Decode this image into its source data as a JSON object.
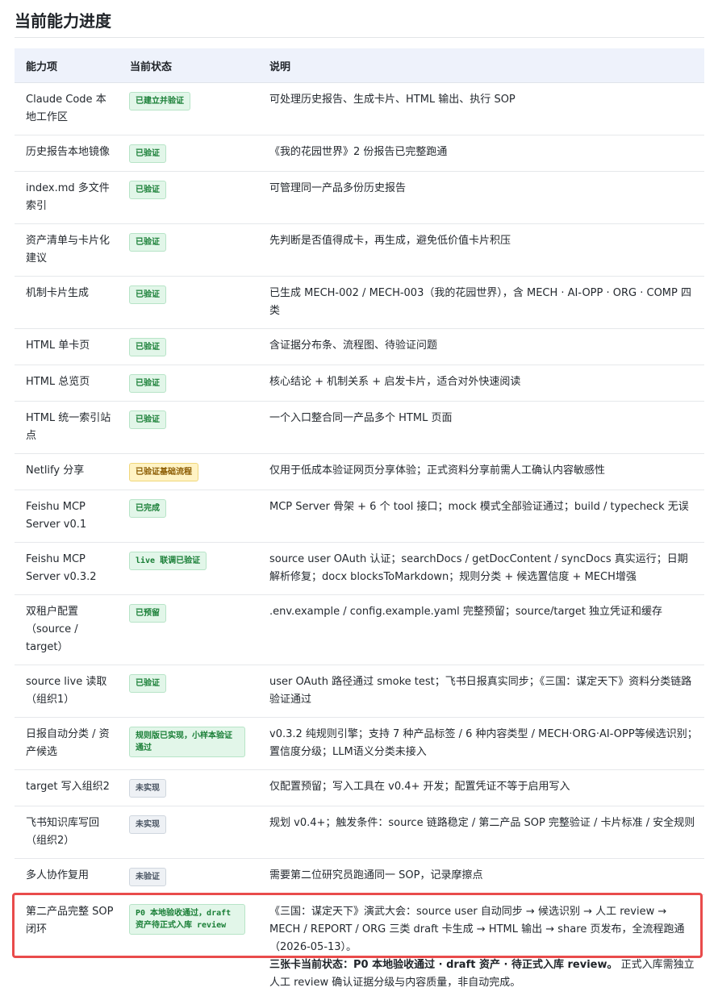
{
  "page": {
    "title": "当前能力进度"
  },
  "table": {
    "headers": [
      "能力项",
      "当前状态",
      "说明"
    ],
    "rows": [
      {
        "item": "Claude Code 本地工作区",
        "status": "已建立并验证",
        "status_color": "green",
        "desc": "可处理历史报告、生成卡片、HTML 输出、执行 SOP"
      },
      {
        "item": "历史报告本地镜像",
        "status": "已验证",
        "status_color": "green",
        "desc": "《我的花园世界》2 份报告已完整跑通"
      },
      {
        "item": "index.md 多文件索引",
        "status": "已验证",
        "status_color": "green",
        "desc": "可管理同一产品多份历史报告"
      },
      {
        "item": "资产清单与卡片化建议",
        "status": "已验证",
        "status_color": "green",
        "desc": "先判断是否值得成卡，再生成，避免低价值卡片积压"
      },
      {
        "item": "机制卡片生成",
        "status": "已验证",
        "status_color": "green",
        "desc": "已生成 MECH-002 / MECH-003（我的花园世界），含 MECH · AI-OPP · ORG · COMP 四类"
      },
      {
        "item": "HTML 单卡页",
        "status": "已验证",
        "status_color": "green",
        "desc": "含证据分布条、流程图、待验证问题"
      },
      {
        "item": "HTML 总览页",
        "status": "已验证",
        "status_color": "green",
        "desc": "核心结论 + 机制关系 + 启发卡片，适合对外快速阅读"
      },
      {
        "item": "HTML 统一索引站点",
        "status": "已验证",
        "status_color": "green",
        "desc": "一个入口整合同一产品多个 HTML 页面"
      },
      {
        "item": "Netlify 分享",
        "status": "已验证基础流程",
        "status_color": "yellow",
        "desc": "仅用于低成本验证网页分享体验；正式资料分享前需人工确认内容敏感性"
      },
      {
        "item": "Feishu MCP Server v0.1",
        "status": "已完成",
        "status_color": "green",
        "desc": "MCP Server 骨架 + 6 个 tool 接口；mock 模式全部验证通过；build / typecheck 无误"
      },
      {
        "item": "Feishu MCP Server v0.3.2",
        "status": "live 联调已验证",
        "status_color": "green",
        "desc": "source user OAuth 认证；searchDocs / getDocContent / syncDocs 真实运行；日期解析修复；docx blocksToMarkdown；规则分类 + 候选置信度 + MECH增强"
      },
      {
        "item": "双租户配置（source / target）",
        "status": "已预留",
        "status_color": "green",
        "desc": ".env.example / config.example.yaml 完整预留；source/target 独立凭证和缓存"
      },
      {
        "item": "source live 读取（组织1）",
        "status": "已验证",
        "status_color": "green",
        "desc": "user OAuth 路径通过 smoke test；飞书日报真实同步；《三国：谋定天下》资料分类链路验证通过"
      },
      {
        "item": "日报自动分类 / 资产候选",
        "status": "规则版已实现，小样本验证通过",
        "status_color": "green",
        "desc": "v0.3.2 纯规则引擎；支持 7 种产品标签 / 6 种内容类型 / MECH·ORG·AI-OPP等候选识别；置信度分级；LLM语义分类未接入"
      },
      {
        "item": "target 写入组织2",
        "status": "未实现",
        "status_color": "gray",
        "desc": "仅配置预留；写入工具在 v0.4+ 开发；配置凭证不等于启用写入"
      },
      {
        "item": "飞书知识库写回（组织2）",
        "status": "未实现",
        "status_color": "gray",
        "desc": "规划 v0.4+；触发条件：source 链路稳定 / 第二产品 SOP 完整验证 / 卡片标准 / 安全规则"
      },
      {
        "item": "多人协作复用",
        "status": "未验证",
        "status_color": "gray",
        "desc": "需要第二位研究员跑通同一 SOP，记录摩擦点"
      }
    ],
    "highlight_row": {
      "item": "第二产品完整 SOP 闭环",
      "status": "P0 本地验收通过，draft 资产待正式入库 review",
      "status_color": "green",
      "desc": "《三国：谋定天下》演武大会：source user 自动同步 → 候选识别 → 人工 review → MECH / REPORT / ORG 三类 draft 卡生成 → HTML 输出 → share 页发布，全流程跑通（2026-05-13）。",
      "desc_bold": "三张卡当前状态：P0 本地验收通过 · draft 资产 · 待正式入库 review。",
      "desc_tail": " 正式入库需独立人工 review 确认证据分级与内容质量，非自动完成。",
      "highlight_color": "#e94b4b"
    }
  },
  "colors": {
    "header_bg": "#eef2fb",
    "badge_green": "#1a7f37",
    "badge_yellow": "#8a5a00",
    "badge_gray": "#4a5563"
  }
}
